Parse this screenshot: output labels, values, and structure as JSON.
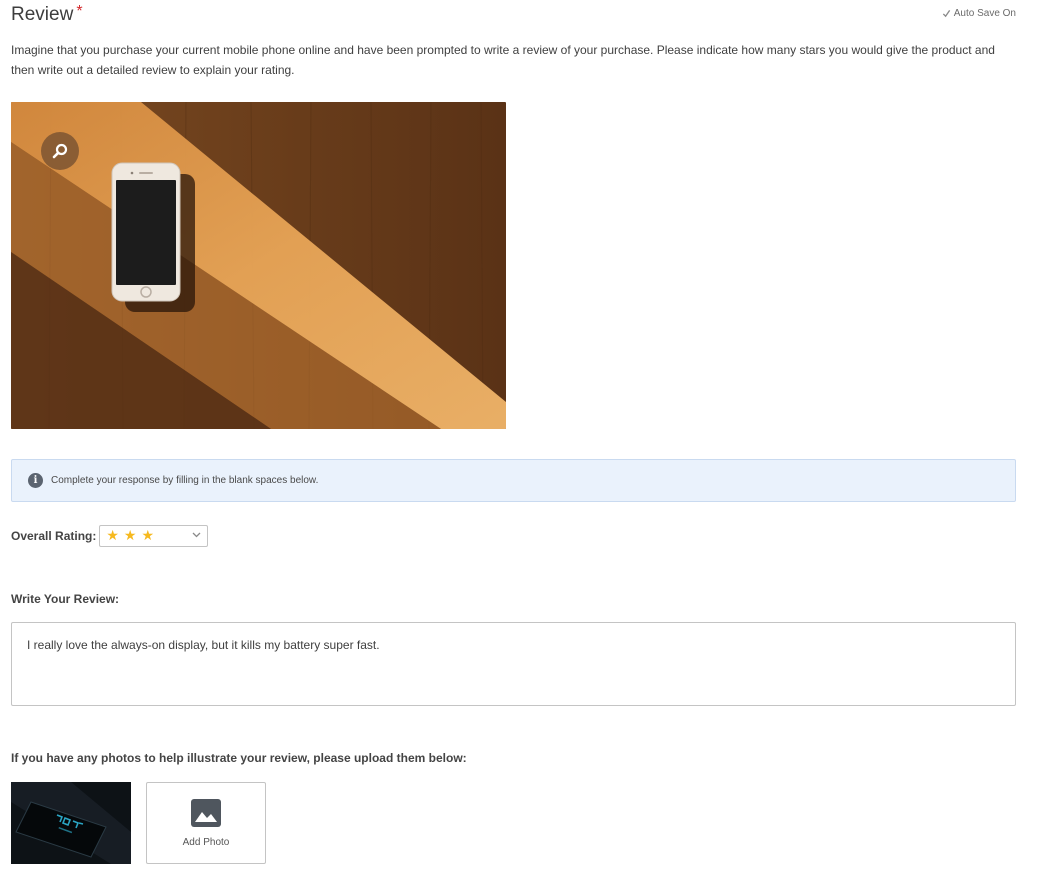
{
  "question": {
    "title": "Review",
    "required_marker": "*",
    "autosave_label": "Auto Save On",
    "prompt": "Imagine that you purchase your current mobile phone online and have been prompted to write a review of your purchase. Please indicate how many stars you would give the product and then write out a detailed review to explain your rating."
  },
  "image": {
    "icon": "phone-on-wood-photo",
    "zoom_icon": "magnifier-icon"
  },
  "info_banner": {
    "icon": "info-icon",
    "icon_glyph": "i",
    "text": "Complete your response by filling in the blank spaces below."
  },
  "rating": {
    "label": "Overall Rating:",
    "selected_value": 3,
    "max": 5,
    "stars_display": "★★★",
    "star_color": "#f6b91f"
  },
  "review": {
    "label": "Write Your Review:",
    "value": "I really love the always-on display, but it kills my battery super fast."
  },
  "photos": {
    "label": "If you have any photos to help illustrate your review, please upload them below:",
    "uploaded": [
      {
        "icon": "dark-phone-clock-photo"
      }
    ],
    "add_label": "Add Photo",
    "add_icon": "image-icon"
  },
  "colors": {
    "banner_bg": "#eaf2fc",
    "required": "#d3272a"
  }
}
